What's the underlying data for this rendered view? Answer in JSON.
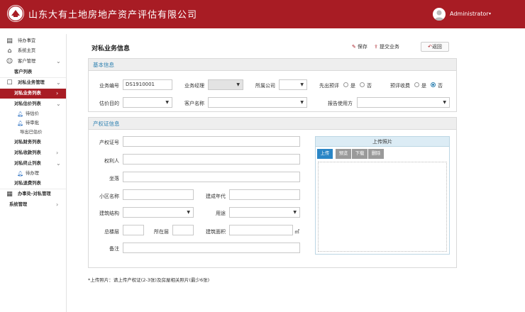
{
  "header": {
    "company_name": "山东大有土地房地产资产评估有限公司",
    "user_name": "Administrator",
    "brand_color": "#a81c24"
  },
  "sidebar": {
    "items": [
      {
        "label": "待办事宜",
        "icon": "document-icon"
      },
      {
        "label": "系统主页",
        "icon": "home-icon"
      },
      {
        "label": "客户管理",
        "icon": "users-icon"
      },
      {
        "label": "客户列表"
      },
      {
        "label": "对私业务管理",
        "icon": "user-icon"
      },
      {
        "label": "对私业务列表"
      },
      {
        "label": "对私估价列表"
      },
      {
        "label": "待估价",
        "icon": "bell-icon"
      },
      {
        "label": "待审批",
        "icon": "bell-icon"
      },
      {
        "label": "导出已估价"
      },
      {
        "label": "对私财务列表"
      },
      {
        "label": "对私收款列表"
      },
      {
        "label": "对私终止列表"
      },
      {
        "label": "待办理",
        "icon": "bell-icon"
      },
      {
        "label": "对私退费列表"
      },
      {
        "label": "办事处-对私管理",
        "icon": "grid-icon"
      },
      {
        "label": "系统管理"
      }
    ]
  },
  "main": {
    "title": "对私业务信息",
    "toolbar": {
      "save": "保存",
      "submit": "提交业务",
      "back": "返回"
    },
    "basic": {
      "heading": "基本信息",
      "business_no_label": "业务编号",
      "business_no_value": "DS1910001",
      "manager_label": "业务经理",
      "company_label": "所属公司",
      "pre_eval_label": "先出预评",
      "yes": "是",
      "no": "否",
      "pre_fee_label": "预评收费",
      "purpose_label": "估价目的",
      "customer_label": "客户名称",
      "report_user_label": "报告使用方"
    },
    "property": {
      "heading": "产权证信息",
      "cert_no": "产权证号",
      "owner": "权利人",
      "location": "坐落",
      "community": "小区名称",
      "build_year": "建成年代",
      "structure": "建筑结构",
      "usage": "用途",
      "total_floors": "总楼层",
      "floor": "所在层",
      "area": "建筑面积",
      "area_unit": "㎡",
      "remarks": "备注"
    },
    "upload": {
      "heading": "上传照片",
      "btn_upload": "上传",
      "btn_preview": "预览",
      "btn_download": "下载",
      "btn_delete": "删除"
    },
    "note": "*上传照片：请上传产权证(2-3张)及房屋相关照片(最少6张)"
  }
}
